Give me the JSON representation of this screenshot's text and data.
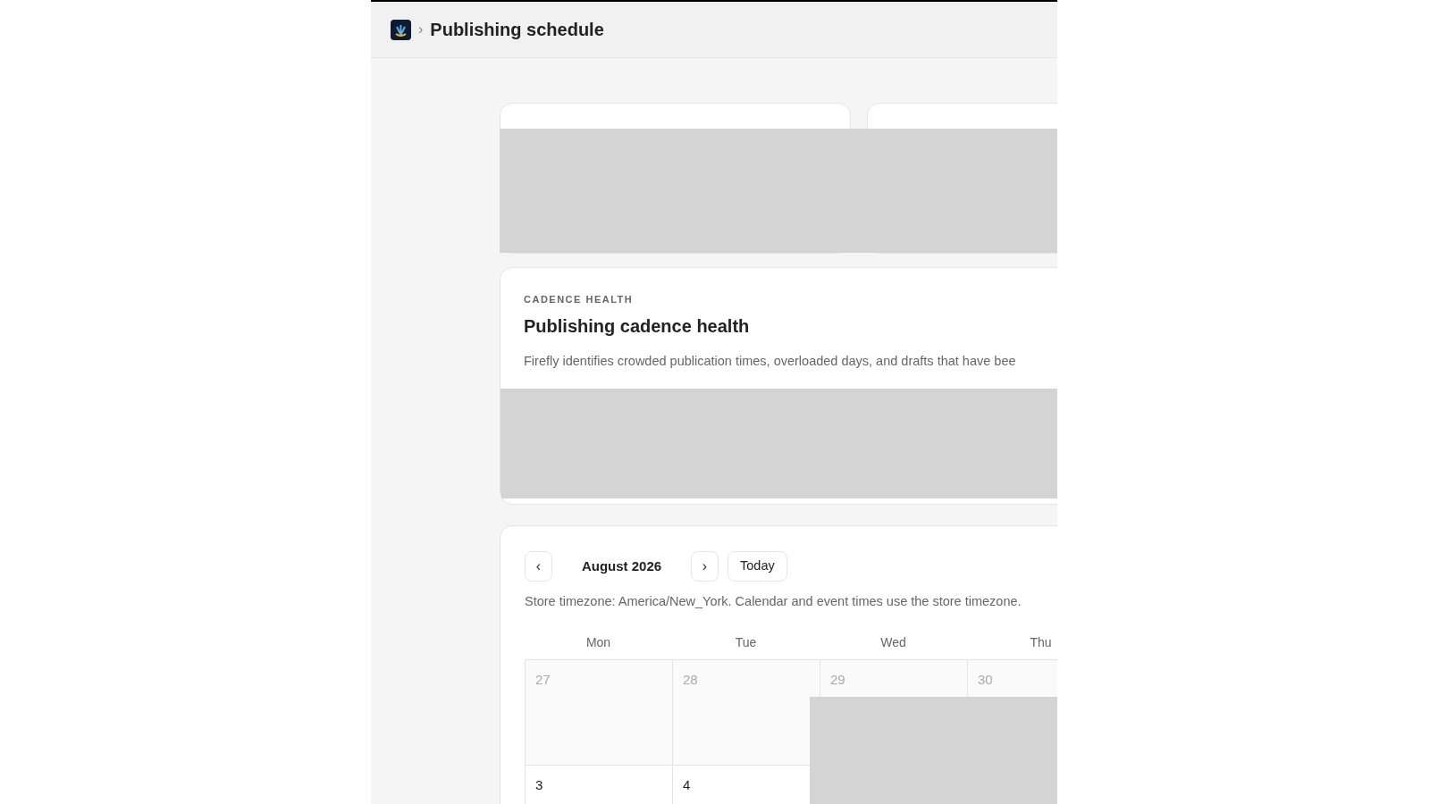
{
  "header": {
    "separator": "›",
    "title": "Publishing schedule"
  },
  "cadence": {
    "eyebrow": "CADENCE HEALTH",
    "title": "Publishing cadence health",
    "description": "Firefly identifies crowded publication times, overloaded days, and drafts that have bee"
  },
  "calendar": {
    "prev": "‹",
    "month": "August 2026",
    "next": "›",
    "today": "Today",
    "note": "Store timezone: America/New_York. Calendar and event times use the store timezone.",
    "weekdays": [
      "Mon",
      "Tue",
      "Wed",
      "Thu"
    ],
    "weeks": [
      [
        {
          "day": "27",
          "in_month": false
        },
        {
          "day": "28",
          "in_month": false
        },
        {
          "day": "29",
          "in_month": false
        },
        {
          "day": "30",
          "in_month": false
        }
      ],
      [
        {
          "day": "3",
          "in_month": true
        },
        {
          "day": "4",
          "in_month": true
        }
      ]
    ]
  }
}
